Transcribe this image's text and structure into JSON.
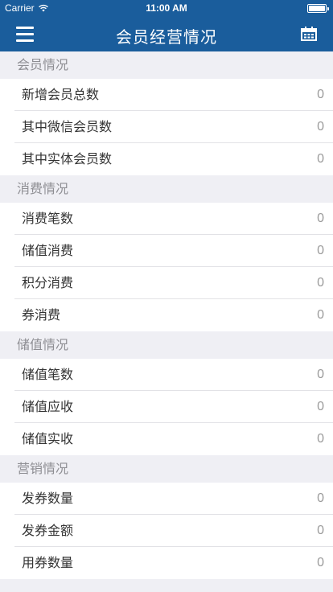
{
  "status_bar": {
    "carrier": "Carrier",
    "time": "11:00 AM",
    "battery_level": 1.0
  },
  "nav": {
    "title": "会员经营情况",
    "menu_icon": "hamburger-menu-icon",
    "right_icon": "calendar-icon"
  },
  "sections": [
    {
      "header": "会员情况",
      "rows": [
        {
          "label": "新增会员总数",
          "value": "0"
        },
        {
          "label": "其中微信会员数",
          "value": "0"
        },
        {
          "label": "其中实体会员数",
          "value": "0"
        }
      ]
    },
    {
      "header": "消费情况",
      "rows": [
        {
          "label": "消费笔数",
          "value": "0"
        },
        {
          "label": "储值消费",
          "value": "0"
        },
        {
          "label": "积分消费",
          "value": "0"
        },
        {
          "label": "券消费",
          "value": "0"
        }
      ]
    },
    {
      "header": "储值情况",
      "rows": [
        {
          "label": "储值笔数",
          "value": "0"
        },
        {
          "label": "储值应收",
          "value": "0"
        },
        {
          "label": "储值实收",
          "value": "0"
        }
      ]
    },
    {
      "header": "营销情况",
      "rows": [
        {
          "label": "发券数量",
          "value": "0"
        },
        {
          "label": "发券金额",
          "value": "0"
        },
        {
          "label": "用券数量",
          "value": "0"
        }
      ]
    }
  ]
}
